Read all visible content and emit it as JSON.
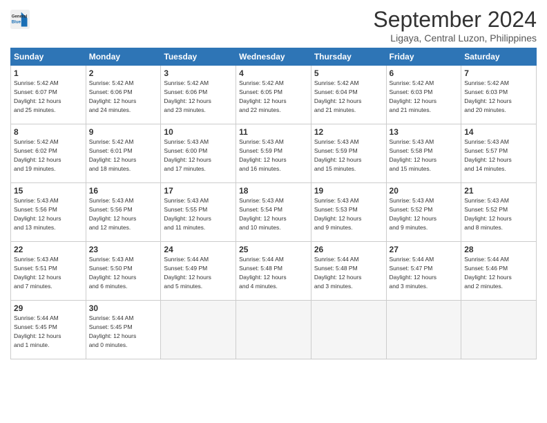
{
  "header": {
    "logo_line1": "General",
    "logo_line2": "Blue",
    "month_title": "September 2024",
    "location": "Ligaya, Central Luzon, Philippines"
  },
  "weekdays": [
    "Sunday",
    "Monday",
    "Tuesday",
    "Wednesday",
    "Thursday",
    "Friday",
    "Saturday"
  ],
  "weeks": [
    [
      {
        "day": "1",
        "info": "Sunrise: 5:42 AM\nSunset: 6:07 PM\nDaylight: 12 hours\nand 25 minutes."
      },
      {
        "day": "2",
        "info": "Sunrise: 5:42 AM\nSunset: 6:06 PM\nDaylight: 12 hours\nand 24 minutes."
      },
      {
        "day": "3",
        "info": "Sunrise: 5:42 AM\nSunset: 6:06 PM\nDaylight: 12 hours\nand 23 minutes."
      },
      {
        "day": "4",
        "info": "Sunrise: 5:42 AM\nSunset: 6:05 PM\nDaylight: 12 hours\nand 22 minutes."
      },
      {
        "day": "5",
        "info": "Sunrise: 5:42 AM\nSunset: 6:04 PM\nDaylight: 12 hours\nand 21 minutes."
      },
      {
        "day": "6",
        "info": "Sunrise: 5:42 AM\nSunset: 6:03 PM\nDaylight: 12 hours\nand 21 minutes."
      },
      {
        "day": "7",
        "info": "Sunrise: 5:42 AM\nSunset: 6:03 PM\nDaylight: 12 hours\nand 20 minutes."
      }
    ],
    [
      {
        "day": "8",
        "info": "Sunrise: 5:42 AM\nSunset: 6:02 PM\nDaylight: 12 hours\nand 19 minutes."
      },
      {
        "day": "9",
        "info": "Sunrise: 5:42 AM\nSunset: 6:01 PM\nDaylight: 12 hours\nand 18 minutes."
      },
      {
        "day": "10",
        "info": "Sunrise: 5:43 AM\nSunset: 6:00 PM\nDaylight: 12 hours\nand 17 minutes."
      },
      {
        "day": "11",
        "info": "Sunrise: 5:43 AM\nSunset: 5:59 PM\nDaylight: 12 hours\nand 16 minutes."
      },
      {
        "day": "12",
        "info": "Sunrise: 5:43 AM\nSunset: 5:59 PM\nDaylight: 12 hours\nand 15 minutes."
      },
      {
        "day": "13",
        "info": "Sunrise: 5:43 AM\nSunset: 5:58 PM\nDaylight: 12 hours\nand 15 minutes."
      },
      {
        "day": "14",
        "info": "Sunrise: 5:43 AM\nSunset: 5:57 PM\nDaylight: 12 hours\nand 14 minutes."
      }
    ],
    [
      {
        "day": "15",
        "info": "Sunrise: 5:43 AM\nSunset: 5:56 PM\nDaylight: 12 hours\nand 13 minutes."
      },
      {
        "day": "16",
        "info": "Sunrise: 5:43 AM\nSunset: 5:56 PM\nDaylight: 12 hours\nand 12 minutes."
      },
      {
        "day": "17",
        "info": "Sunrise: 5:43 AM\nSunset: 5:55 PM\nDaylight: 12 hours\nand 11 minutes."
      },
      {
        "day": "18",
        "info": "Sunrise: 5:43 AM\nSunset: 5:54 PM\nDaylight: 12 hours\nand 10 minutes."
      },
      {
        "day": "19",
        "info": "Sunrise: 5:43 AM\nSunset: 5:53 PM\nDaylight: 12 hours\nand 9 minutes."
      },
      {
        "day": "20",
        "info": "Sunrise: 5:43 AM\nSunset: 5:52 PM\nDaylight: 12 hours\nand 9 minutes."
      },
      {
        "day": "21",
        "info": "Sunrise: 5:43 AM\nSunset: 5:52 PM\nDaylight: 12 hours\nand 8 minutes."
      }
    ],
    [
      {
        "day": "22",
        "info": "Sunrise: 5:43 AM\nSunset: 5:51 PM\nDaylight: 12 hours\nand 7 minutes."
      },
      {
        "day": "23",
        "info": "Sunrise: 5:43 AM\nSunset: 5:50 PM\nDaylight: 12 hours\nand 6 minutes."
      },
      {
        "day": "24",
        "info": "Sunrise: 5:44 AM\nSunset: 5:49 PM\nDaylight: 12 hours\nand 5 minutes."
      },
      {
        "day": "25",
        "info": "Sunrise: 5:44 AM\nSunset: 5:48 PM\nDaylight: 12 hours\nand 4 minutes."
      },
      {
        "day": "26",
        "info": "Sunrise: 5:44 AM\nSunset: 5:48 PM\nDaylight: 12 hours\nand 3 minutes."
      },
      {
        "day": "27",
        "info": "Sunrise: 5:44 AM\nSunset: 5:47 PM\nDaylight: 12 hours\nand 3 minutes."
      },
      {
        "day": "28",
        "info": "Sunrise: 5:44 AM\nSunset: 5:46 PM\nDaylight: 12 hours\nand 2 minutes."
      }
    ],
    [
      {
        "day": "29",
        "info": "Sunrise: 5:44 AM\nSunset: 5:45 PM\nDaylight: 12 hours\nand 1 minute."
      },
      {
        "day": "30",
        "info": "Sunrise: 5:44 AM\nSunset: 5:45 PM\nDaylight: 12 hours\nand 0 minutes."
      },
      {
        "day": "",
        "info": ""
      },
      {
        "day": "",
        "info": ""
      },
      {
        "day": "",
        "info": ""
      },
      {
        "day": "",
        "info": ""
      },
      {
        "day": "",
        "info": ""
      }
    ]
  ]
}
